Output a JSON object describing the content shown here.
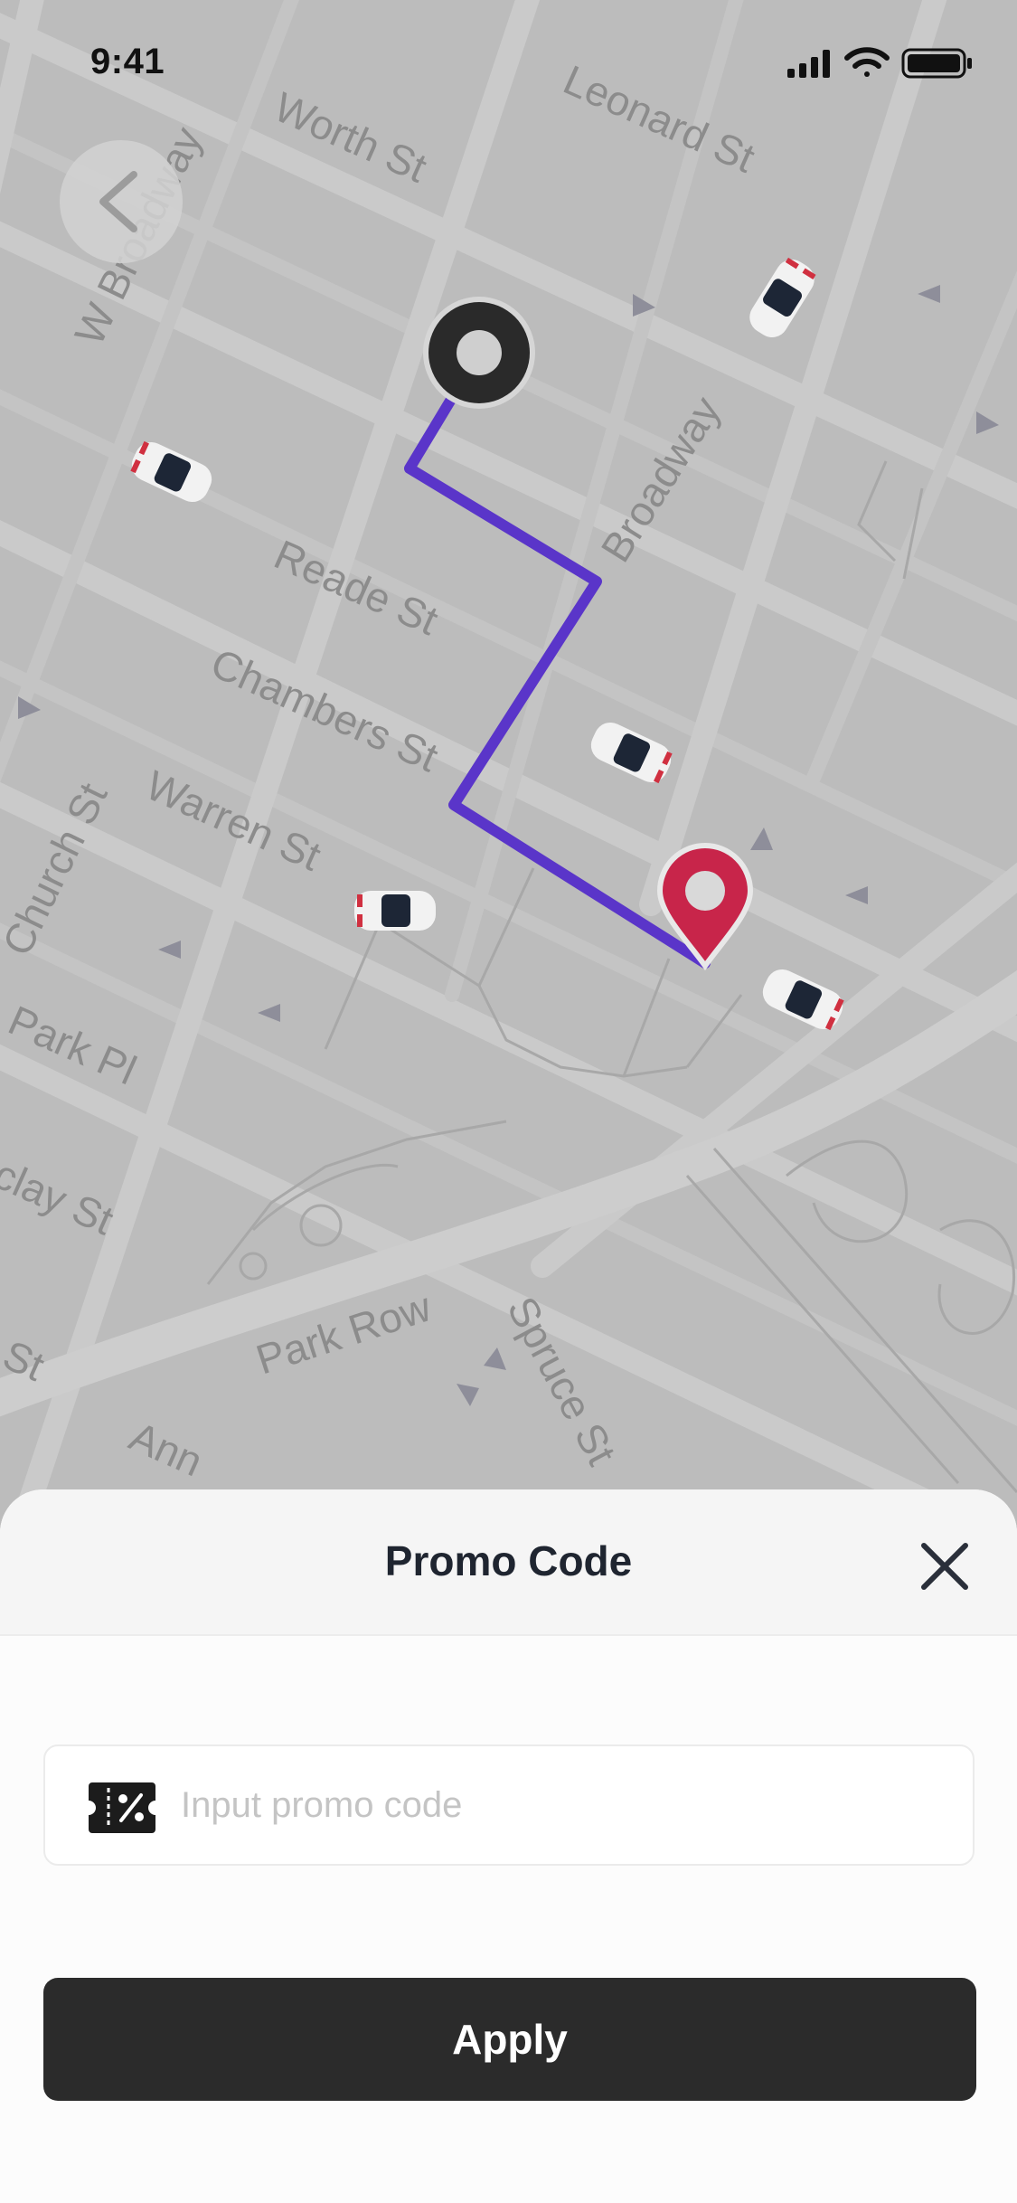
{
  "status_bar": {
    "time": "9:41"
  },
  "map": {
    "streets": [
      "Worth St",
      "Leonard St",
      "W Broadway",
      "Broadway",
      "Reade St",
      "Chambers St",
      "Warren St",
      "Church St",
      "Park Pl",
      "clay St",
      "Park Row",
      "Spruce St",
      "St",
      "Ann"
    ]
  },
  "sheet": {
    "title": "Promo Code",
    "promo_field": {
      "value": "",
      "placeholder": "Input promo code"
    },
    "apply_label": "Apply"
  },
  "colors": {
    "route": "#5a35c9",
    "destination_pin": "#c8254a",
    "primary_button": "#2b2b2b",
    "origin_marker": "#2a2a2a"
  },
  "icons": [
    "back-chevron-icon",
    "origin-marker-icon",
    "destination-pin-icon",
    "car-icon",
    "close-icon",
    "ticket-percent-icon",
    "cellular-signal-icon",
    "wifi-icon",
    "battery-icon"
  ]
}
